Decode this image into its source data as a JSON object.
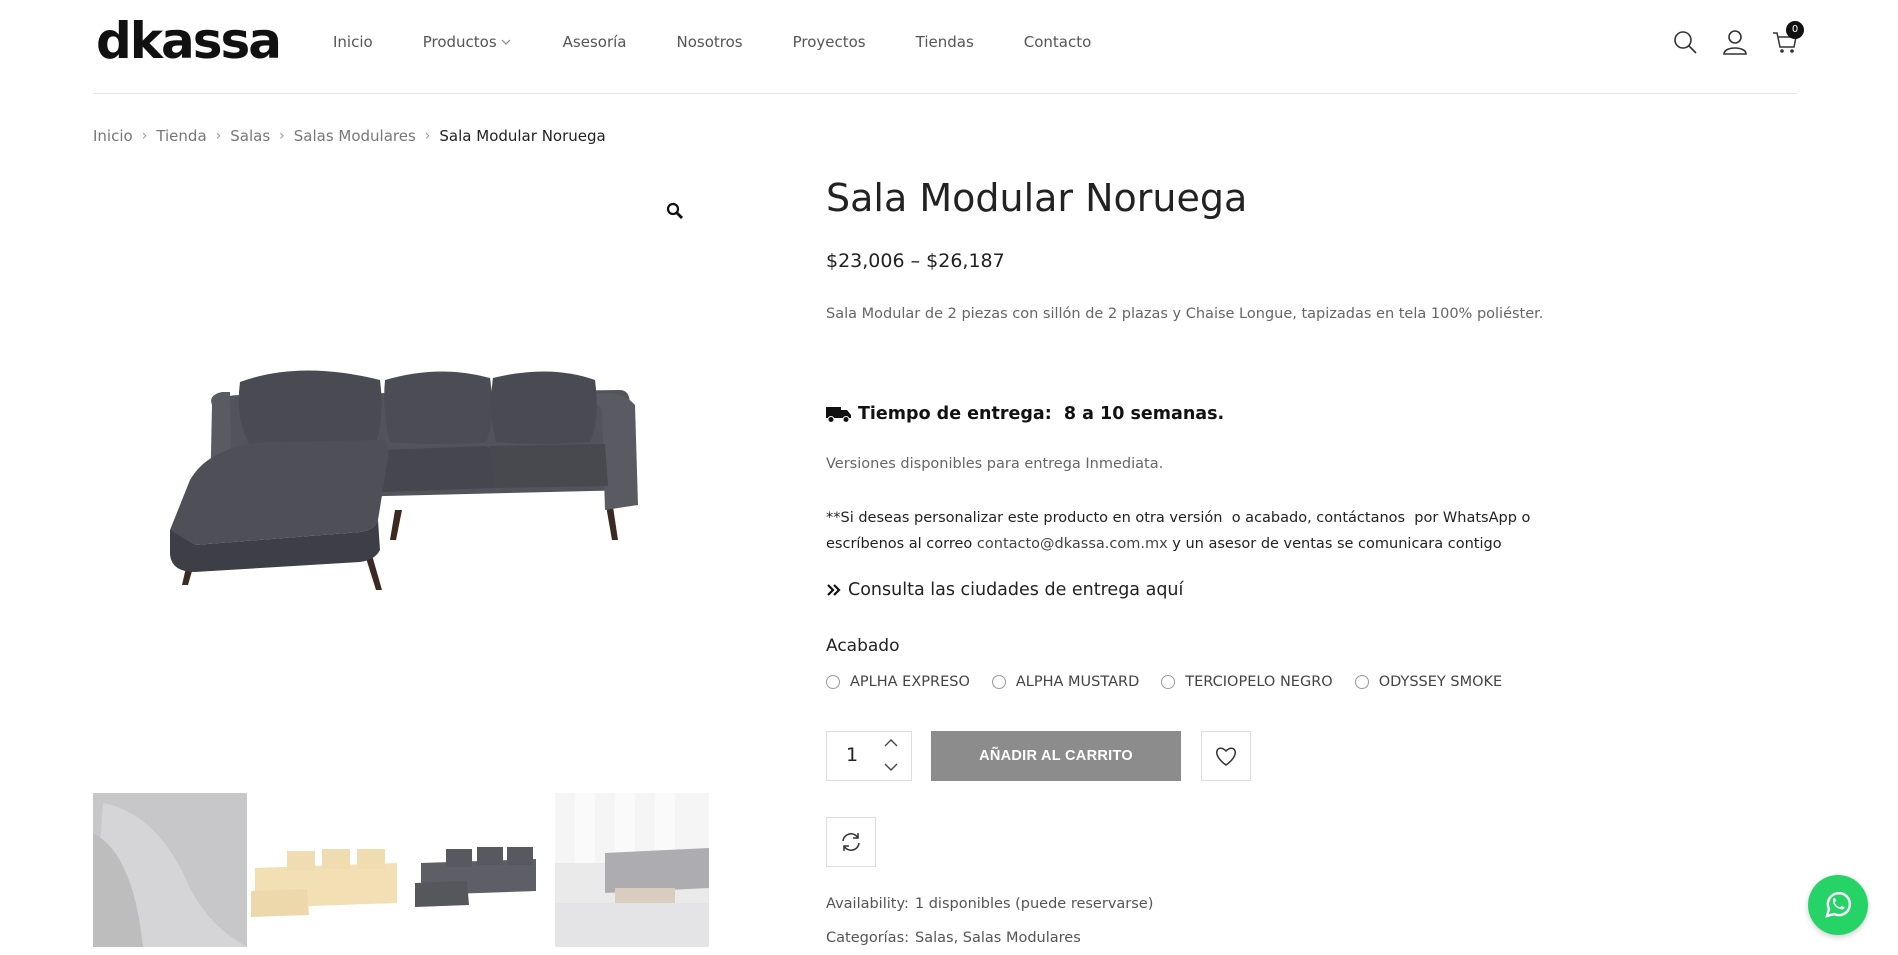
{
  "header": {
    "logo_text": "dkassa",
    "nav": [
      {
        "label": "Inicio"
      },
      {
        "label": "Productos"
      },
      {
        "label": "Asesoría"
      },
      {
        "label": "Nosotros"
      },
      {
        "label": "Proyectos"
      },
      {
        "label": "Tiendas"
      },
      {
        "label": "Contacto"
      }
    ],
    "cart_count": "0"
  },
  "breadcrumb": {
    "items": [
      "Inicio",
      "Tienda",
      "Salas",
      "Salas Modulares"
    ],
    "current": "Sala Modular Noruega"
  },
  "product": {
    "title": "Sala Modular Noruega",
    "price": "$23,006 – $26,187",
    "description": "Sala Modular de 2 piezas con sillón de 2 plazas y Chaise Longue, tapizadas en tela 100% poliéster.",
    "delivery": "Tiempo de entrega:  8 a 10 semanas.",
    "versions": "Versiones disponibles para entrega Inmediata.",
    "custom_1": "**Si deseas personalizar este producto en otra versión  o acabado, contáctanos  por WhatsApp o",
    "custom_2a": "escríbenos al correo ",
    "custom_email": "contacto@dkassa.com.mx",
    "custom_2b": " y un asesor de ventas se comunicara contigo",
    "consulta": "Consulta las ciudades de entrega aquí",
    "acabado_label": "Acabado",
    "acabados": [
      "APLHA EXPRESO",
      "ALPHA MUSTARD",
      "TERCIOPELO NEGRO",
      "ODYSSEY SMOKE"
    ],
    "quantity": "1",
    "add_to_cart": "AÑADIR AL CARRITO",
    "availability_label": "Availability:",
    "availability_value": "1 disponibles (puede reservarse)",
    "categories_label": "Categorías:",
    "category_1": "Salas",
    "category_2": "Salas Modulares"
  },
  "colors": {
    "accent": "#8c8c8c",
    "whatsapp": "#25D366",
    "sofa": "#4a4a52"
  }
}
